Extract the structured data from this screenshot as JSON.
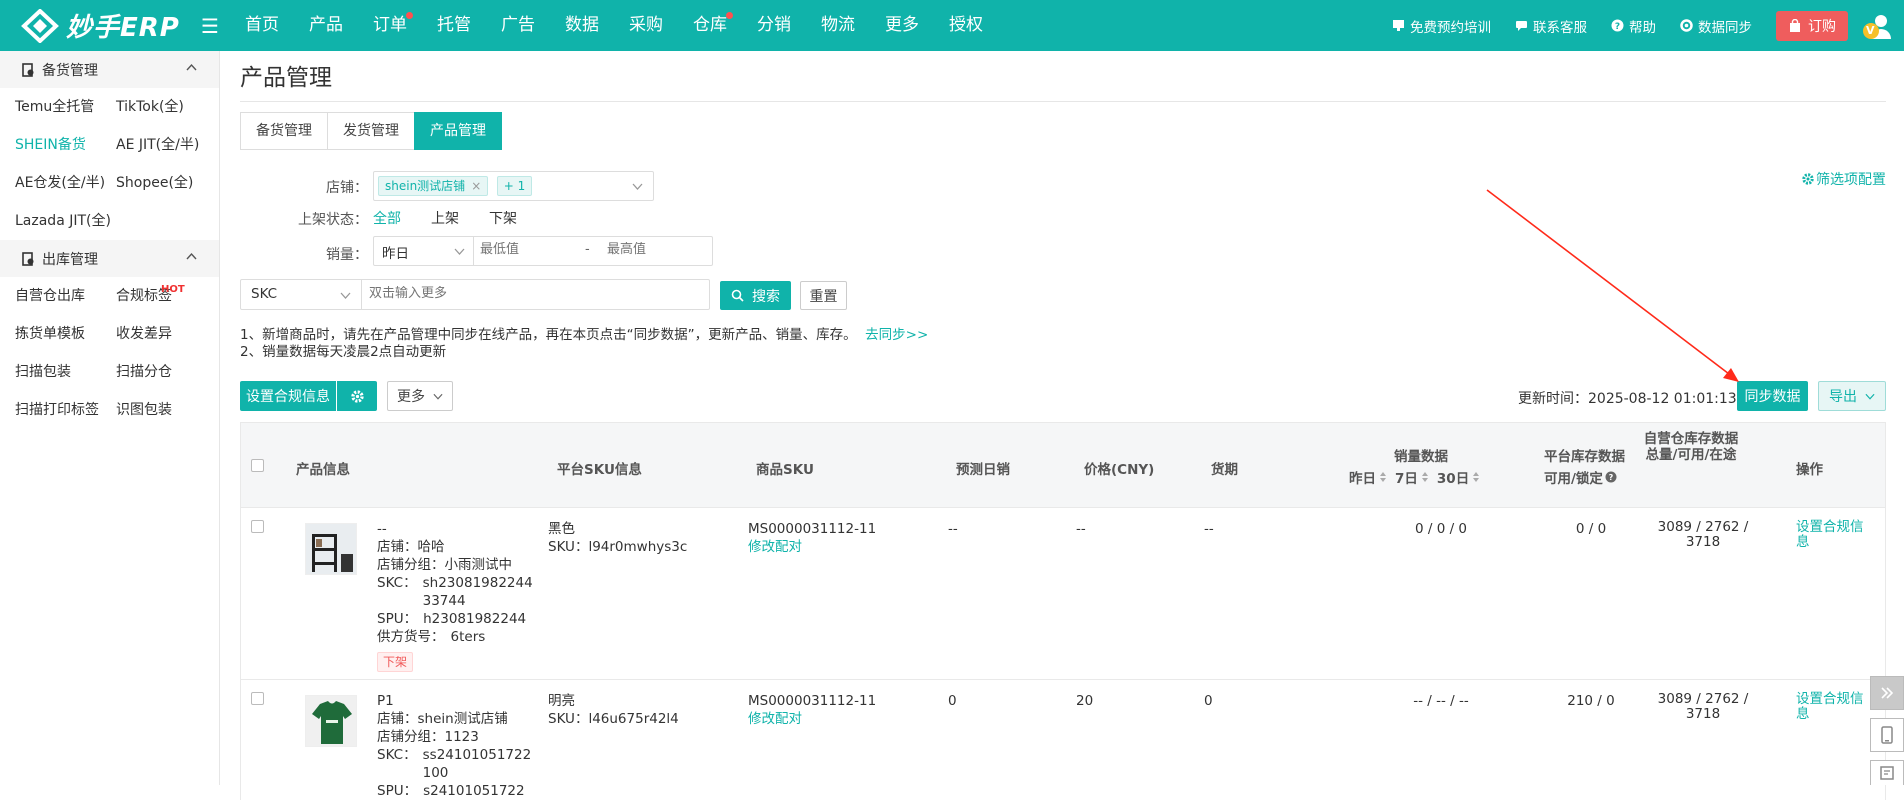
{
  "header": {
    "logo_text": "妙手ERP",
    "nav": [
      "首页",
      "产品",
      "订单",
      "托管",
      "广告",
      "数据",
      "采购",
      "仓库",
      "分销",
      "物流",
      "更多",
      "授权"
    ],
    "right": {
      "training": "免费预约培训",
      "service": "联系客服",
      "help": "帮助",
      "sync": "数据同步",
      "order": "订购"
    },
    "avatar_badge": "V"
  },
  "sidebar": {
    "group1": {
      "title": "备货管理",
      "items": [
        "Temu全托管",
        "TikTok(全)",
        "SHEIN备货",
        "AE JIT(全/半)",
        "AE仓发(全/半)",
        "Shopee(全)",
        "Lazada JIT(全)"
      ]
    },
    "group2": {
      "title": "出库管理",
      "items": [
        "自营仓出库",
        "合规标签",
        "拣货单模板",
        "收发差异",
        "扫描包装",
        "扫描分仓",
        "扫描打印标签",
        "识图包装"
      ]
    },
    "hot_label": "HOT"
  },
  "main": {
    "title": "产品管理",
    "tabs": [
      "备货管理",
      "发货管理",
      "产品管理"
    ],
    "filter_config": "筛选项配置",
    "filters": {
      "shop_label": "店铺：",
      "shop_tag": "shein测试店铺",
      "shop_more": "+ 1",
      "status_label": "上架状态：",
      "status_options": [
        "全部",
        "上架",
        "下架"
      ],
      "sales_label": "销量：",
      "sales_period": "昨日",
      "min_placeholder": "最低值",
      "dash": "-",
      "max_placeholder": "最高值"
    },
    "search": {
      "field": "SKC",
      "placeholder": "双击输入更多",
      "search_btn": "搜索",
      "reset_btn": "重置"
    },
    "notice": {
      "line1": "1、新增商品时，请先在产品管理中同步在线产品，再在本页点击“同步数据”，更新产品、销量、库存。",
      "line1_link": "去同步>>",
      "line2": "2、销量数据每天凌晨2点自动更新"
    },
    "toolbar": {
      "set_compliance": "设置合规信息",
      "more": "更多",
      "update_label": "更新时间：",
      "update_time": "2025-08-12 01:01:13",
      "sync_btn": "同步数据",
      "export_btn": "导出"
    },
    "table": {
      "headers": {
        "product": "产品信息",
        "platform_sku": "平台SKU信息",
        "goods_sku": "商品SKU",
        "forecast": "预测日销",
        "price": "价格(CNY)",
        "lead": "货期",
        "sales": "销量数据",
        "sales_yesterday": "昨日",
        "sales_7": "7日",
        "sales_30": "30日",
        "platform_stock": "平台库存数据",
        "platform_stock_sub": "可用/锁定",
        "own_stock": "自营仓库存数据",
        "own_stock_sub": "总量/可用/在途",
        "ops": "操作"
      },
      "rows": [
        {
          "name": "--",
          "shop": "店铺：哈哈",
          "shop_group": "店铺分组：小雨测试中",
          "skc_label": "SKC：",
          "skc_value": "sh2308198224433744",
          "skc_line1": "sh23081982244",
          "skc_line2": "33744",
          "spu_label": "SPU：",
          "spu_value": "h23081982244",
          "supplier_label": "供方货号：",
          "supplier_value": "6ters",
          "status": "下架",
          "color": "黑色",
          "platform_sku": "SKU：l94r0mwhys3c",
          "goods_sku": "MS0000031112-11",
          "edit_match": "修改配对",
          "forecast": "--",
          "price": "--",
          "lead": "--",
          "sales": "0 / 0 / 0",
          "platform_stock": "0 / 0",
          "own_stock_1": "3089 / 2762 /",
          "own_stock_2": "3718",
          "op_1": "设置合规信",
          "op_2": "息"
        },
        {
          "name": "P1",
          "shop": "店铺：shein测试店铺",
          "shop_group": "店铺分组：1123",
          "skc_label": "SKC：",
          "skc_line1": "ss24101051722",
          "skc_line2": "100",
          "spu_label": "SPU：",
          "spu_value": "s24101051722",
          "color": "明亮",
          "platform_sku": "SKU：l46u675r42l4",
          "goods_sku": "MS0000031112-11",
          "edit_match": "修改配对",
          "forecast": "0",
          "price": "20",
          "lead": "0",
          "sales": "-- / -- / --",
          "platform_stock": "210 / 0",
          "own_stock_1": "3089 / 2762 /",
          "own_stock_2": "3718",
          "op_1": "设置合规信",
          "op_2": "息"
        }
      ]
    }
  },
  "colors": {
    "brand": "#10b3aa",
    "danger": "#ef5d5d",
    "annotation_arrow": "#ff2a1a"
  }
}
